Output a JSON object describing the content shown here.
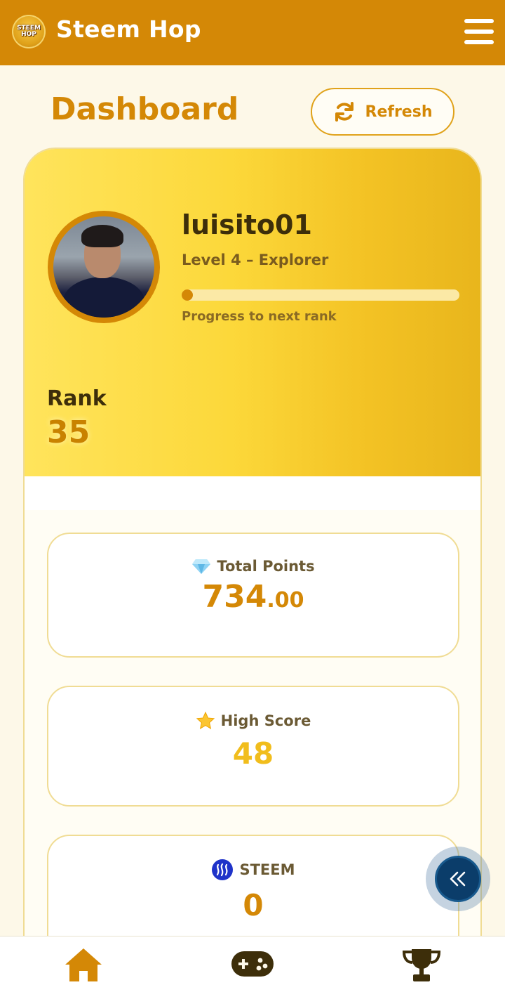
{
  "header": {
    "logo_text": "STEEM HOP",
    "app_title": "Steem Hop"
  },
  "dashboard": {
    "title": "Dashboard",
    "refresh_label": "Refresh"
  },
  "profile": {
    "username": "luisito01",
    "level_text": "Level 4 – Explorer",
    "progress_fraction": 0.02,
    "progress_note": "Progress to next rank",
    "rank_label": "Rank",
    "rank_value": "35"
  },
  "stats": {
    "total_points": {
      "label": "Total Points",
      "icon": "diamond-icon",
      "int": "734",
      "dec": ".00"
    },
    "high_score": {
      "label": "High Score",
      "icon": "star-icon",
      "value": "48"
    },
    "steem": {
      "label": "STEEM",
      "icon": "steem-icon",
      "value": "0"
    }
  },
  "nav": {
    "items": [
      {
        "name": "home",
        "icon": "home-icon"
      },
      {
        "name": "game",
        "icon": "gamepad-icon"
      },
      {
        "name": "leaderboard",
        "icon": "trophy-icon"
      }
    ]
  },
  "colors": {
    "brand": "#d48806",
    "hero_start": "#ffe45c",
    "hero_end": "#e8b51c",
    "fab": "#0b3d6a"
  }
}
